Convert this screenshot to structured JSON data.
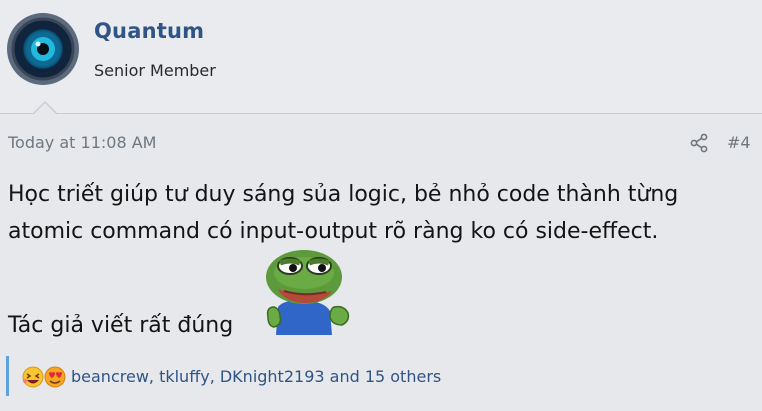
{
  "user": {
    "name": "Quantum",
    "title": "Senior Member"
  },
  "post": {
    "date": "Today at 11:08 AM",
    "number": "#4",
    "lines": [
      "Học triết giúp tư duy sáng sủa logic, bẻ nhỏ code thành từng",
      "atomic command có input-output rõ ràng ko có side-effect.",
      "Tác giả viết rất đúng"
    ]
  },
  "reactions": {
    "icons": [
      "haha-emoji-icon",
      "love-emoji-icon"
    ],
    "text": "beancrew, tkluffy, DKnight2193 and 15 others"
  },
  "colors": {
    "background": "#e9ebee",
    "username": "#2f5486",
    "meta": "#6f7780",
    "reaction_border": "#5fa0e0"
  },
  "icons": {
    "share": "share-icon",
    "smilie": "pepe-sticker"
  }
}
